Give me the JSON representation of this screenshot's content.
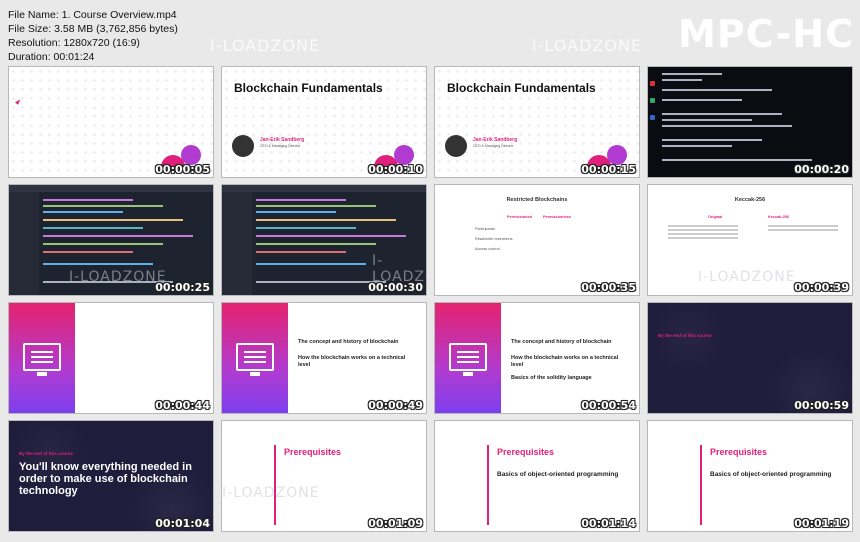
{
  "header": {
    "file_name": "File Name: 1. Course Overview.mp4",
    "file_size": "File Size: 3.58 MB (3,762,856 bytes)",
    "resolution": "Resolution: 1280x720 (16:9)",
    "duration": "Duration: 00:01:24"
  },
  "player_logo": "MPC-HC",
  "watermark": "I-LOADZONE",
  "slides": {
    "title": "Blockchain Fundamentals",
    "author_name": "Jan-Erik Sandberg",
    "author_title": "CEO & Managing Director",
    "restricted_title": "Restricted Blockchains",
    "restricted_headers": [
      "Permissioned",
      "Permissionless"
    ],
    "restricted_rows": [
      "Participants",
      "Read/write restrictions",
      "Access control"
    ],
    "keccak_title": "Keccak-256",
    "keccak_headers": [
      "Original",
      "Keccak-256"
    ],
    "concept": "The concept and history of blockchain",
    "how_works": "How the blockchain works on a technical level",
    "solidity": "Basics of the solidity language",
    "by_end": "By the end of this course",
    "know_everything": "You'll know everything needed in order to make use of blockchain technology",
    "prereq_title": "Prerequisites",
    "prereq_item": "Basics of object-oriented programming"
  },
  "timestamps": [
    "00:00:05",
    "00:00:10",
    "00:00:15",
    "00:00:20",
    "00:00:25",
    "00:00:30",
    "00:00:35",
    "00:00:39",
    "00:00:44",
    "00:00:49",
    "00:00:54",
    "00:00:59",
    "00:01:04",
    "00:01:09",
    "00:01:14",
    "00:01:19"
  ],
  "colors": {
    "accent": "#e0207a",
    "dark_bg": "#201c3c",
    "code_bg": "#1e2330"
  }
}
